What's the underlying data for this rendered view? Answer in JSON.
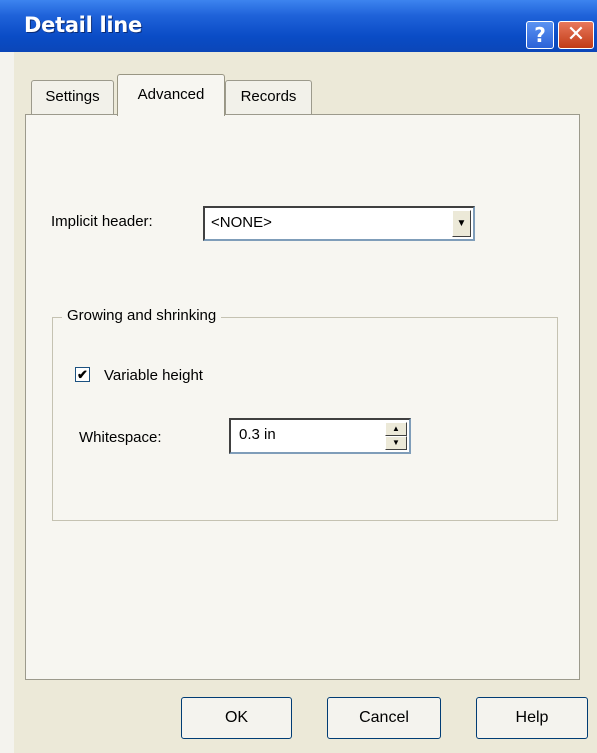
{
  "window": {
    "title": "Detail line",
    "help_glyph": "?",
    "close_glyph": "✕"
  },
  "tabs": [
    {
      "label": "Settings",
      "active": false
    },
    {
      "label": "Advanced",
      "active": true
    },
    {
      "label": "Records",
      "active": false
    }
  ],
  "implicit_header": {
    "label": "Implicit header:",
    "value": "<NONE>",
    "arrow": "▼"
  },
  "growing": {
    "legend": "Growing and shrinking",
    "variable_height": {
      "label": "Variable height",
      "checked": true,
      "mark": "✔"
    },
    "whitespace": {
      "label": "Whitespace:",
      "value": "0.3 in",
      "up": "▲",
      "down": "▼"
    }
  },
  "buttons": {
    "ok": "OK",
    "cancel": "Cancel",
    "help": "Help"
  },
  "colors": {
    "title_bar": "#0a4cc6",
    "dialog_bg": "#ece9d8",
    "close_button": "#c13b16"
  }
}
